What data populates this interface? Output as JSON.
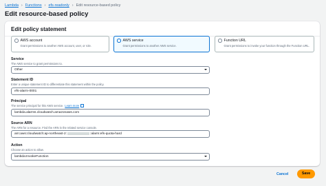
{
  "breadcrumbs": [
    {
      "label": "Lambda"
    },
    {
      "label": "Functions"
    },
    {
      "label": "efs-readonly"
    },
    {
      "label": "Edit resource-based policy"
    }
  ],
  "page_title": "Edit resource-based policy",
  "panel": {
    "heading": "Edit policy statement",
    "tiles": [
      {
        "label": "AWS account",
        "description": "Grant permissions to another AWS account, user, or role.",
        "selected": false
      },
      {
        "label": "AWS service",
        "description": "Grant permissions to another AWS service.",
        "selected": true
      },
      {
        "label": "Function URL",
        "description": "Grant permissions to invoke your function through the Function URL.",
        "selected": false
      }
    ]
  },
  "fields": {
    "service": {
      "label": "Service",
      "description": "The AWS service to grant permissions to.",
      "value": "Other"
    },
    "statement_id": {
      "label": "Statement ID",
      "description": "Enter a unique statement ID to differentiate this statement within the policy.",
      "value": "efs-alarm-0001"
    },
    "principal": {
      "label": "Principal",
      "description": "The service principal for this AWS service.",
      "link": "Learn more",
      "value": "lambda.alarms.cloudwatch.amazonaws.com"
    },
    "source_arn": {
      "label": "Source ARN",
      "description": "The ARN for a resource. Find the ARN in the related service console.",
      "value_prefix": "arn:aws:cloudwatch:ap-northeast-2:",
      "value_suffix": ":alarm:efs-quota-hard"
    },
    "action": {
      "label": "Action",
      "description": "Choose an action to allow.",
      "value": "lambda:InvokeFunction"
    }
  },
  "buttons": {
    "cancel": "Cancel",
    "save": "Save"
  },
  "colors": {
    "link": "#0972d3",
    "primary_button": "#ff9900",
    "selected_border": "#0972d3",
    "background": "#f2f3f3"
  }
}
